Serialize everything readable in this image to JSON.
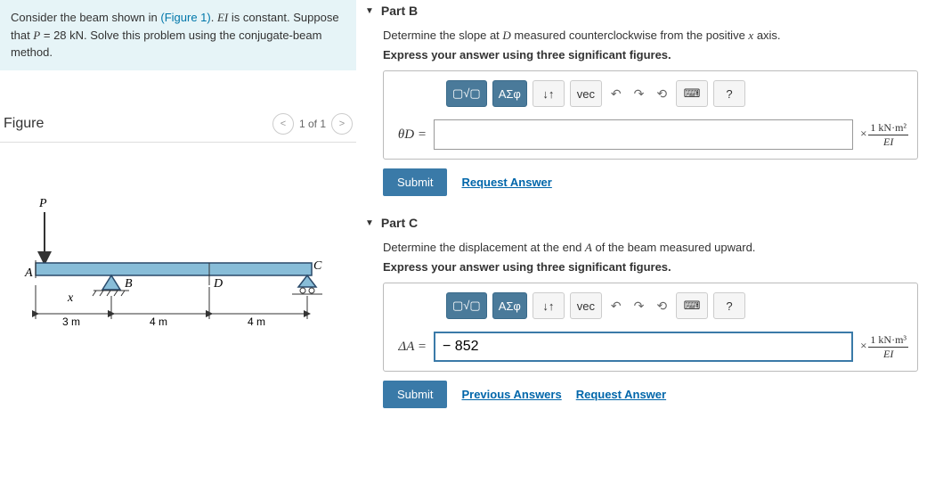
{
  "problem": {
    "text_before_link": "Consider the beam shown in ",
    "link_text": "(Figure 1)",
    "text_after_link": ". ",
    "ei_var": "EI",
    "ei_text": " is constant. Suppose that ",
    "p_var": "P",
    "p_text": " = 28 kN. Solve this problem using the conjugate-beam method."
  },
  "figure": {
    "title": "Figure",
    "pager": "1 of 1",
    "labels": {
      "P": "P",
      "A": "A",
      "B": "B",
      "C": "C",
      "D": "D",
      "x": "x"
    },
    "dims": {
      "d1": "3 m",
      "d2": "4 m",
      "d3": "4 m"
    }
  },
  "parts": {
    "b": {
      "title": "Part B",
      "prompt_before": "Determine the slope at ",
      "prompt_var": "D",
      "prompt_mid": " measured counterclockwise from the positive ",
      "prompt_var2": "x",
      "prompt_after": " axis.",
      "express": "Express your answer using three significant figures.",
      "var_label": "θD =",
      "value": "",
      "unit_num": "1 kN·m²",
      "unit_den": "EI",
      "submit": "Submit",
      "request": "Request Answer"
    },
    "c": {
      "title": "Part C",
      "prompt_before": "Determine the displacement at the end ",
      "prompt_var": "A",
      "prompt_after": " of the beam measured upward.",
      "express": "Express your answer using three significant figures.",
      "var_label": "ΔA =",
      "value": "− 852",
      "unit_num": "1 kN·m³",
      "unit_den": "EI",
      "submit": "Submit",
      "previous": "Previous Answers",
      "request": "Request Answer"
    }
  },
  "toolbar": {
    "templates": "▢√▢",
    "greek": "ΑΣφ",
    "subsup": "↓↑",
    "vec": "vec",
    "undo": "↶",
    "redo": "↷",
    "reset": "⟲",
    "keyboard": "⌨",
    "help": "?"
  }
}
